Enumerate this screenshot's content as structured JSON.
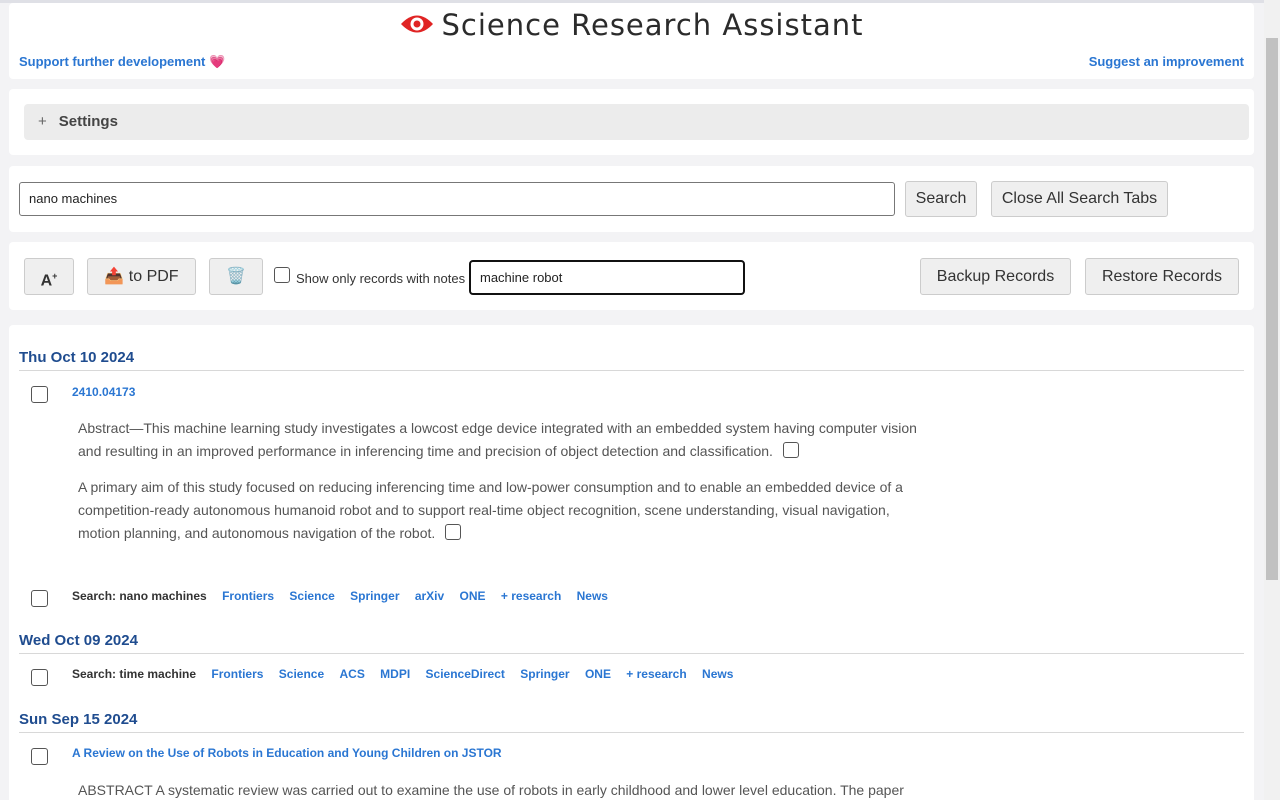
{
  "header": {
    "title": "Science Research Assistant",
    "support_link": "Support further developement 💗",
    "suggest_link": "Suggest an improvement",
    "logo_color": "#e02424"
  },
  "settings": {
    "toggle": "+",
    "label": "Settings"
  },
  "search": {
    "value": "nano machines",
    "search_button": "Search",
    "close_tabs_button": "Close All Search Tabs"
  },
  "toolbar": {
    "font_button": "A",
    "pdf_button": "📤 to PDF",
    "trash_button": "🗑️",
    "notes_filter_label": "Show only records with notes",
    "filter_value": "machine robot",
    "backup_button": "Backup Records",
    "restore_button": "Restore Records"
  },
  "records": {
    "day1": {
      "date": "Thu Oct 10 2024",
      "item_link": "2410.04173",
      "para1": "Abstract—This machine learning study investigates a lowcost edge device integrated with an embedded system having computer vision and resulting in an improved performance in inferencing time and precision of object detection and classification.",
      "para2": "A primary aim of this study focused on reducing inferencing time and low-power consumption and to enable an embedded device of a competition-ready autonomous humanoid robot and to support real-time object recognition, scene understanding, visual navigation, motion planning, and autonomous navigation of the robot.",
      "search_label": "Search: nano machines",
      "sources": [
        "Frontiers",
        "Science",
        "Springer",
        "arXiv",
        "ONE",
        "+ research",
        "News"
      ]
    },
    "day2": {
      "date": "Wed Oct 09 2024",
      "search_label": "Search: time machine",
      "sources": [
        "Frontiers",
        "Science",
        "ACS",
        "MDPI",
        "ScienceDirect",
        "Springer",
        "ONE",
        "+ research",
        "News"
      ]
    },
    "day3": {
      "date": "Sun Sep 15 2024",
      "item_link": "A Review on the Use of Robots in Education and Young Children on JSTOR",
      "para1": "ABSTRACT A systematic review was carried out to examine the use of robots in early childhood and lower level education. The paper"
    }
  }
}
